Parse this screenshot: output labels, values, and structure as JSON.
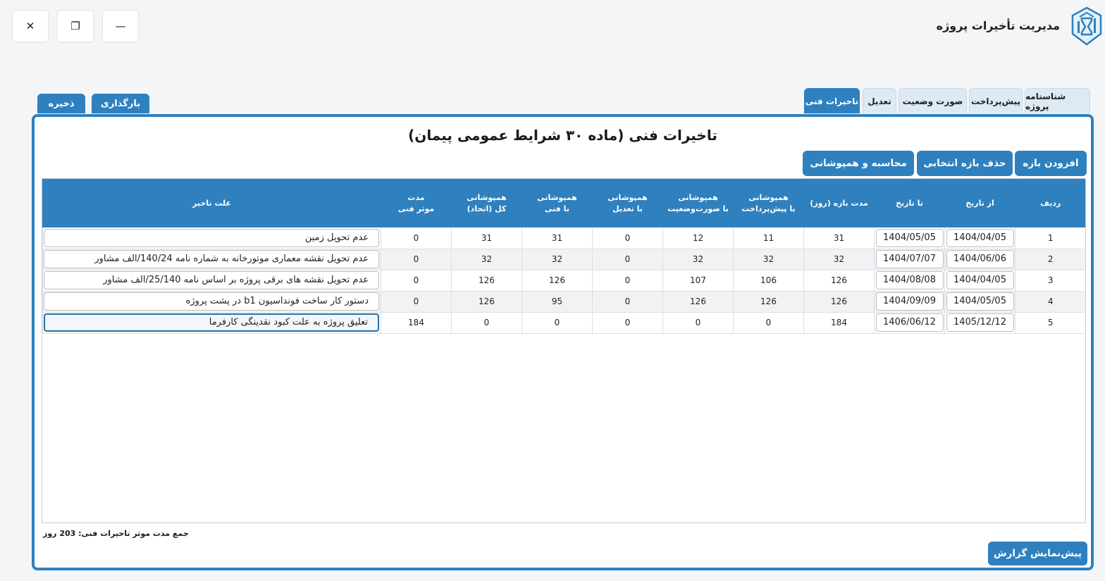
{
  "window": {
    "title": "مدیریت تأخیرات پروژه",
    "close_glyph": "✕",
    "restore_glyph": "❐",
    "minimize_glyph": "—"
  },
  "toolbar": {
    "save_label": "ذخیره",
    "load_label": "بارگذاری"
  },
  "tabs": [
    {
      "label": "شناسنامه پروژه",
      "active": false
    },
    {
      "label": "پیش‌پرداخت",
      "active": false
    },
    {
      "label": "صورت وضعیت",
      "active": false
    },
    {
      "label": "تعدیل",
      "active": false
    },
    {
      "label": "تاخیرات فنی",
      "active": true
    }
  ],
  "panel": {
    "title": "تاخیرات فنی (ماده ۳۰ شرایط عمومی پیمان)",
    "add_label": "افزودن بازه",
    "delete_label": "حذف بازه انتخابی",
    "calc_label": "محاسبه و همپوشانی",
    "total_text": "جمع مدت موثر تاخیرات فنی: 203 روز",
    "preview_label": "پیش‌نمایش گزارش"
  },
  "table": {
    "headers": [
      {
        "line1": "ردیف",
        "line2": ""
      },
      {
        "line1": "از تاریخ",
        "line2": ""
      },
      {
        "line1": "تا تاریخ",
        "line2": ""
      },
      {
        "line1": "مدت بازه (روز)",
        "line2": ""
      },
      {
        "line1": "همپوشانی",
        "line2": "با پیش‌پرداخت"
      },
      {
        "line1": "همپوشانی",
        "line2": "با صورت‌وضعیت"
      },
      {
        "line1": "همپوشانی",
        "line2": "با تعدیل"
      },
      {
        "line1": "همپوشانی",
        "line2": "با فنی"
      },
      {
        "line1": "همپوشانی",
        "line2": "کل (اتحاد)"
      },
      {
        "line1": "مدت",
        "line2": "موثر فنی"
      },
      {
        "line1": "علت تاخیر",
        "line2": ""
      }
    ],
    "rows": [
      {
        "idx": "1",
        "from": "1404/04/05",
        "to": "1404/05/05",
        "days": "31",
        "ov_prepay": "11",
        "ov_status": "12",
        "ov_adjust": "0",
        "ov_tech": "31",
        "ov_total": "31",
        "effective": "0",
        "reason": "عدم تحویل زمین"
      },
      {
        "idx": "2",
        "from": "1404/06/06",
        "to": "1404/07/07",
        "days": "32",
        "ov_prepay": "32",
        "ov_status": "32",
        "ov_adjust": "0",
        "ov_tech": "32",
        "ov_total": "32",
        "effective": "0",
        "reason": "عدم تحویل نقشه معماری موتورخانه به شماره نامه 140/24/الف مشاور"
      },
      {
        "idx": "3",
        "from": "1404/04/05",
        "to": "1404/08/08",
        "days": "126",
        "ov_prepay": "106",
        "ov_status": "107",
        "ov_adjust": "0",
        "ov_tech": "126",
        "ov_total": "126",
        "effective": "0",
        "reason": "عدم تحویل نقشه های برقی پروژه بر اساس نامه 25/140/الف مشاور"
      },
      {
        "idx": "4",
        "from": "1404/05/05",
        "to": "1404/09/09",
        "days": "126",
        "ov_prepay": "126",
        "ov_status": "126",
        "ov_adjust": "0",
        "ov_tech": "95",
        "ov_total": "126",
        "effective": "0",
        "reason": "دستور کار ساخت فونداسیون b1  در پشت پروژه"
      },
      {
        "idx": "5",
        "from": "1405/12/12",
        "to": "1406/06/12",
        "days": "184",
        "ov_prepay": "0",
        "ov_status": "0",
        "ov_adjust": "0",
        "ov_tech": "0",
        "ov_total": "0",
        "effective": "184",
        "reason": "تعلیق پروژه به علت کبود نقدینگی کارفرما"
      }
    ]
  },
  "colors": {
    "accent": "#2e80be",
    "tab_inactive": "#dde9f3"
  }
}
